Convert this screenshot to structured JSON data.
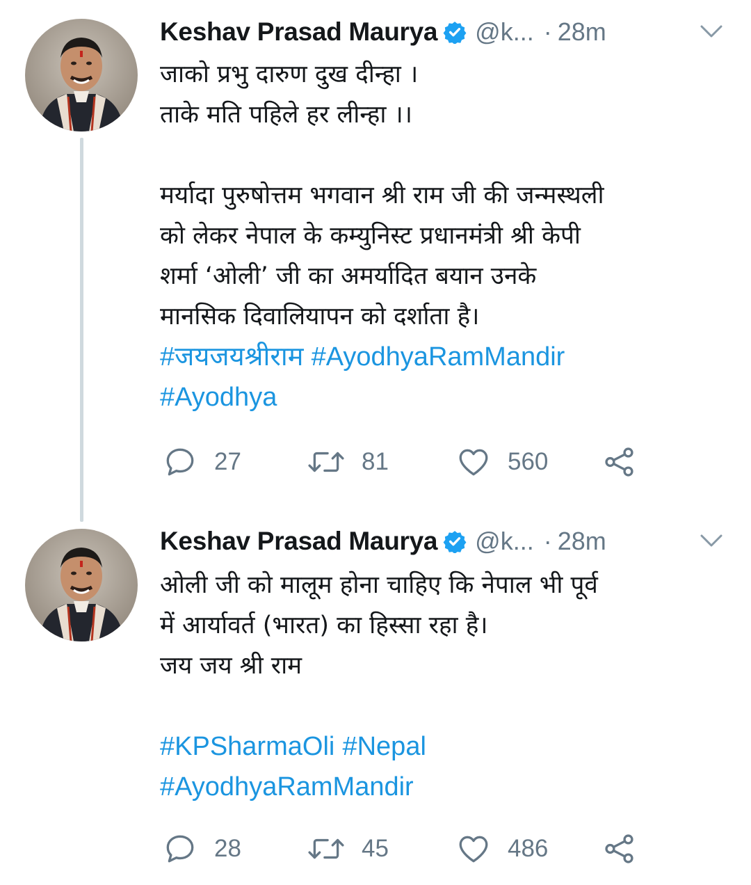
{
  "tweets": [
    {
      "author": {
        "name": "Keshav Prasad Maurya",
        "handle": "@k...",
        "avatar_icon": "profile-photo",
        "verified": true
      },
      "separator": "·",
      "time": "28m",
      "lines": [
        "जाको प्रभु दारुण दुख दीन्हा ।",
        "ताके मति पहिले हर लीन्हा ।।",
        "",
        "मर्यादा पुरुषोत्तम भगवान श्री राम जी की जन्मस्थली",
        "को लेकर नेपाल के कम्युनिस्ट प्रधानमंत्री श्री केपी",
        "शर्मा ‘ओली’ जी का अमर्यादित बयान उनके",
        "मानसिक दिवालियापन को दर्शाता है।"
      ],
      "hashtag_lines": [
        [
          "#जयजयश्रीराम",
          "#AyodhyaRamMandir"
        ],
        [
          "#Ayodhya"
        ]
      ],
      "stats": {
        "replies": "27",
        "retweets": "81",
        "likes": "560"
      }
    },
    {
      "author": {
        "name": "Keshav Prasad Maurya",
        "handle": "@k...",
        "avatar_icon": "profile-photo",
        "verified": true
      },
      "separator": "·",
      "time": "28m",
      "lines": [
        "ओली जी को मालूम होना चाहिए कि नेपाल भी पूर्व",
        "में आर्यावर्त (भारत) का हिस्सा रहा है।",
        "जय जय श्री राम",
        ""
      ],
      "hashtag_lines": [
        [
          "#KPSharmaOli",
          "#Nepal"
        ],
        [
          "#AyodhyaRamMandir"
        ]
      ],
      "stats": {
        "replies": "28",
        "retweets": "45",
        "likes": "486"
      }
    }
  ],
  "colors": {
    "hashtag": "#1b95e0",
    "muted": "#657786",
    "verified": "#1da1f2",
    "thread_line": "#cfd9de"
  },
  "icons": {
    "reply": "reply-icon",
    "retweet": "retweet-icon",
    "like": "heart-icon",
    "share": "share-icon",
    "menu": "chevron-down-icon",
    "verified": "verified-badge-icon"
  }
}
